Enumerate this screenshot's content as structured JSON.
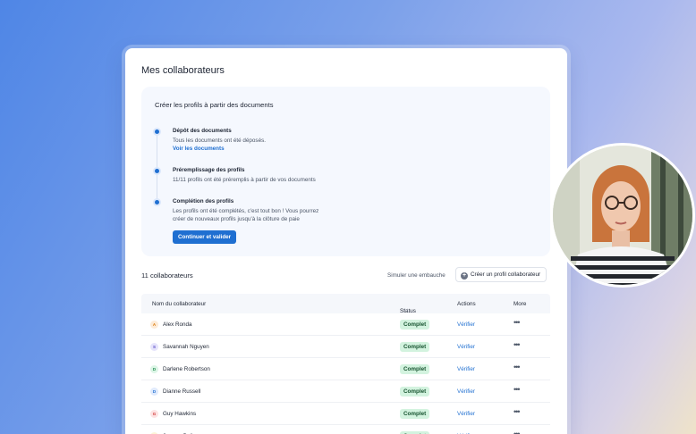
{
  "page": {
    "title": "Mes collaborateurs"
  },
  "onboarding": {
    "title": "Créer les profils à partir des documents",
    "steps": [
      {
        "title": "Dépôt des documents",
        "lines": [
          "Tous les documents ont été déposés."
        ],
        "link": "Voir les documents"
      },
      {
        "title": "Préremplissage des profils",
        "lines": [
          "11/11 profils ont été préremplis à partir de vos documents"
        ]
      },
      {
        "title": "Complétion des profils",
        "lines": [
          "Les profils ont été complétés, c'est tout bon ! Vous pourrez",
          "créer de nouveaux profils jusqu'à la clôture de paie"
        ]
      }
    ],
    "cta_label": "Continuer et valider"
  },
  "toolbar": {
    "count_label": "11 collaborateurs",
    "simulate_label": "Simuler une embauche",
    "create_label": "Créer un profil collaborateur",
    "create_icon": "plus-circle-icon"
  },
  "table": {
    "headers": {
      "name": "Nom du collaborateur",
      "status": "Status",
      "actions": "Actions",
      "more": "More"
    },
    "rows": [
      {
        "initial": "A",
        "name": "Alex Ronda",
        "status": "Complet",
        "action": "Vérifier",
        "avatar_bg": "#fdebd7",
        "avatar_fg": "#d97706"
      },
      {
        "initial": "S",
        "name": "Savannah Nguyen",
        "status": "Complet",
        "action": "Vérifier",
        "avatar_bg": "#e6e4fb",
        "avatar_fg": "#5b4fc7"
      },
      {
        "initial": "D",
        "name": "Darlene Robertson",
        "status": "Complet",
        "action": "Vérifier",
        "avatar_bg": "#dcf5e6",
        "avatar_fg": "#1f8a4c"
      },
      {
        "initial": "D",
        "name": "Dianne Russell",
        "status": "Complet",
        "action": "Vérifier",
        "avatar_bg": "#dfeafc",
        "avatar_fg": "#1f6fd1"
      },
      {
        "initial": "G",
        "name": "Guy Hawkins",
        "status": "Complet",
        "action": "Vérifier",
        "avatar_bg": "#fde3e3",
        "avatar_fg": "#d13a3a"
      },
      {
        "initial": "J",
        "name": "Jerome Bell",
        "status": "Complet",
        "action": "Vérifier",
        "avatar_bg": "#fdf3d6",
        "avatar_fg": "#b58a06"
      }
    ]
  },
  "colors": {
    "accent": "#1f6fd1",
    "status_complete_bg": "#d3f3df",
    "status_complete_fg": "#16532f"
  }
}
